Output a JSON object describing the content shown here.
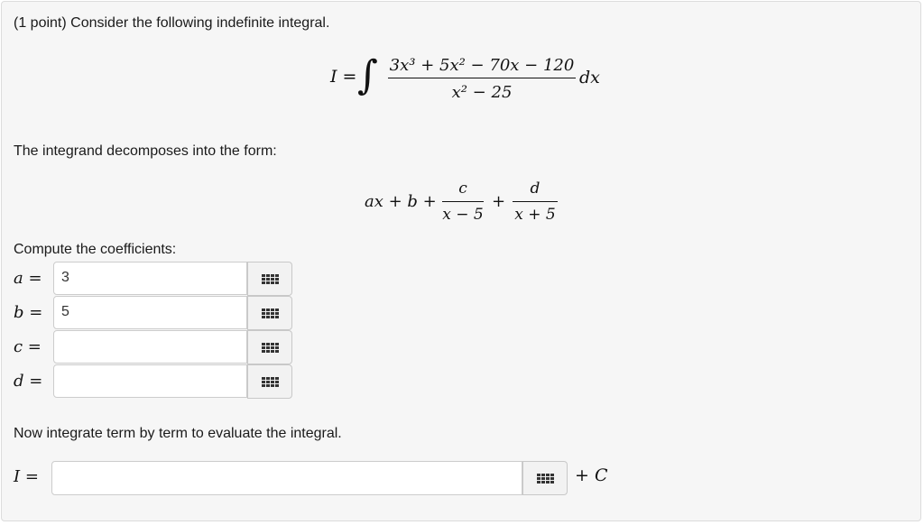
{
  "problem": {
    "intro": "(1 point) Consider the following indefinite integral.",
    "form_text": "The integrand decomposes into the form:",
    "compute_text": "Compute the coefficients:",
    "integrate_text": "Now integrate term by term to evaluate the integral."
  },
  "integral": {
    "lhs": "I =",
    "numerator": "3x³ + 5x² − 70x − 120",
    "denominator": "x² − 25",
    "differential": "dx"
  },
  "decomposition": {
    "lead": "ax + b +",
    "c_num": "c",
    "c_den": "x − 5",
    "plus": "+",
    "d_num": "d",
    "d_den": "x + 5"
  },
  "coefficients": [
    {
      "label": "a =",
      "value": "3"
    },
    {
      "label": "b =",
      "value": "5"
    },
    {
      "label": "c =",
      "value": ""
    },
    {
      "label": "d =",
      "value": ""
    }
  ],
  "answer": {
    "label": "I =",
    "value": "",
    "suffix": "+ C"
  },
  "icons": {
    "palette": "equation-editor-grid-icon"
  }
}
